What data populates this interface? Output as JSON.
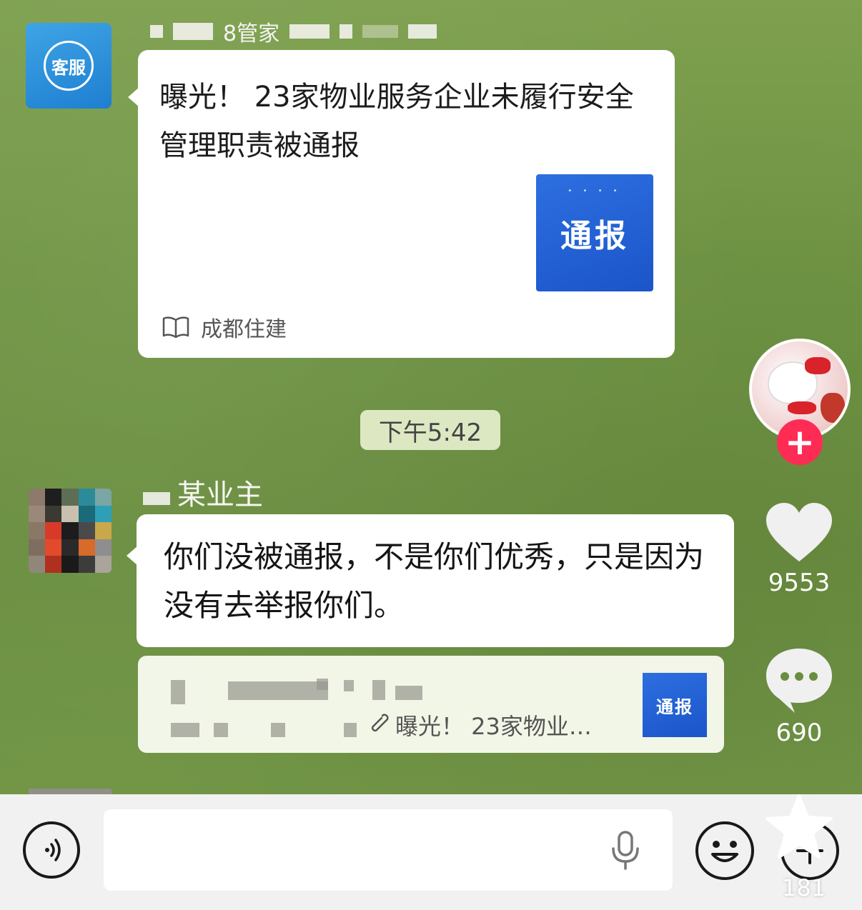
{
  "top_message": {
    "sender_name": "8管家",
    "card_title": "曝光！ 23家物业服务企业未履行安全管理职责被通报",
    "card_thumb_text": "通报",
    "card_source": "成都住建",
    "avatar_label": "客服"
  },
  "time_divider": "下午5:42",
  "owner_message": {
    "sender_name": "某业主",
    "text": "你们没被通报，不是你们优秀，只是因为没有去举报你们。"
  },
  "quote": {
    "text": "曝光！ 23家物业…",
    "thumb_text": "通报"
  },
  "side_actions": {
    "likes": "9553",
    "comments": "690",
    "favorites": "181"
  },
  "colors": {
    "follow": "#fe2c55",
    "thumb": "#1b55c9",
    "background": "#6f9443"
  }
}
